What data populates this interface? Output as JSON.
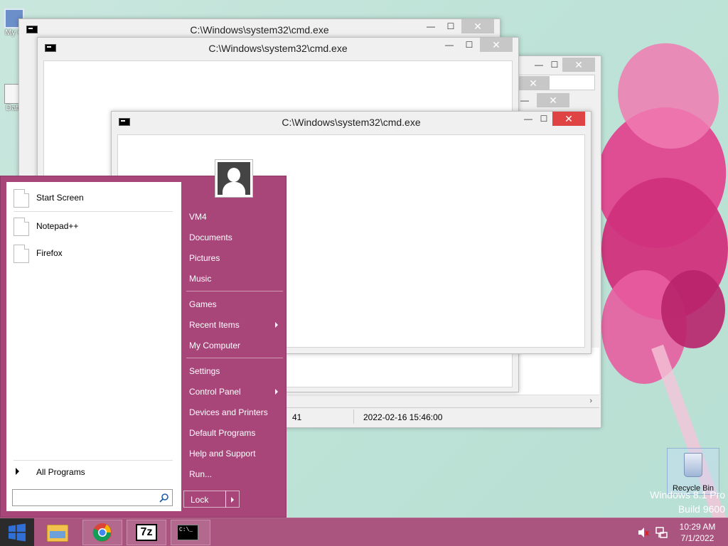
{
  "desktop": {
    "icons": [
      {
        "label": "My C"
      },
      {
        "label": "Data"
      }
    ],
    "recycle_bin": {
      "label": "Recycle Bin"
    },
    "watermark": {
      "line1": "Windows 8.1 Pro",
      "line2": "Build 9600"
    }
  },
  "windows": [
    {
      "title": "C:\\Windows\\system32\\cmd.exe"
    },
    {
      "title": "C:\\Windows\\system32\\cmd.exe"
    },
    {
      "title": "C:\\Windows\\system32\\cmd.exe"
    }
  ],
  "window_controls": {
    "minimize": "—",
    "maximize": "☐",
    "close": "✕"
  },
  "background_window": {
    "status_value": "41",
    "status_date": "2022-02-16 15:46:00"
  },
  "start_menu": {
    "pinned": [
      {
        "label": "Start Screen"
      },
      {
        "label": "Notepad++"
      },
      {
        "label": "Firefox"
      }
    ],
    "all_programs": "All Programs",
    "search_placeholder": "",
    "right_items": [
      {
        "label": "VM4"
      },
      {
        "label": "Documents"
      },
      {
        "label": "Pictures"
      },
      {
        "label": "Music"
      },
      {
        "label": "Games"
      },
      {
        "label": "Recent Items"
      },
      {
        "label": "My Computer"
      },
      {
        "label": "Settings"
      },
      {
        "label": "Control Panel"
      },
      {
        "label": "Devices and Printers"
      },
      {
        "label": "Default Programs"
      },
      {
        "label": "Help and Support"
      },
      {
        "label": "Run..."
      }
    ],
    "lock_label": "Lock"
  },
  "taskbar": {
    "apps": [
      {
        "name": "file-explorer"
      },
      {
        "name": "chrome"
      },
      {
        "name": "7-zip",
        "label": "7z"
      },
      {
        "name": "cmd",
        "label": "C:\\_"
      }
    ],
    "clock": {
      "time": "10:29 AM",
      "date": "7/1/2022"
    }
  },
  "colors": {
    "accent": "#a8467a",
    "taskbar": "#a9557f",
    "close_red": "#e04343"
  }
}
